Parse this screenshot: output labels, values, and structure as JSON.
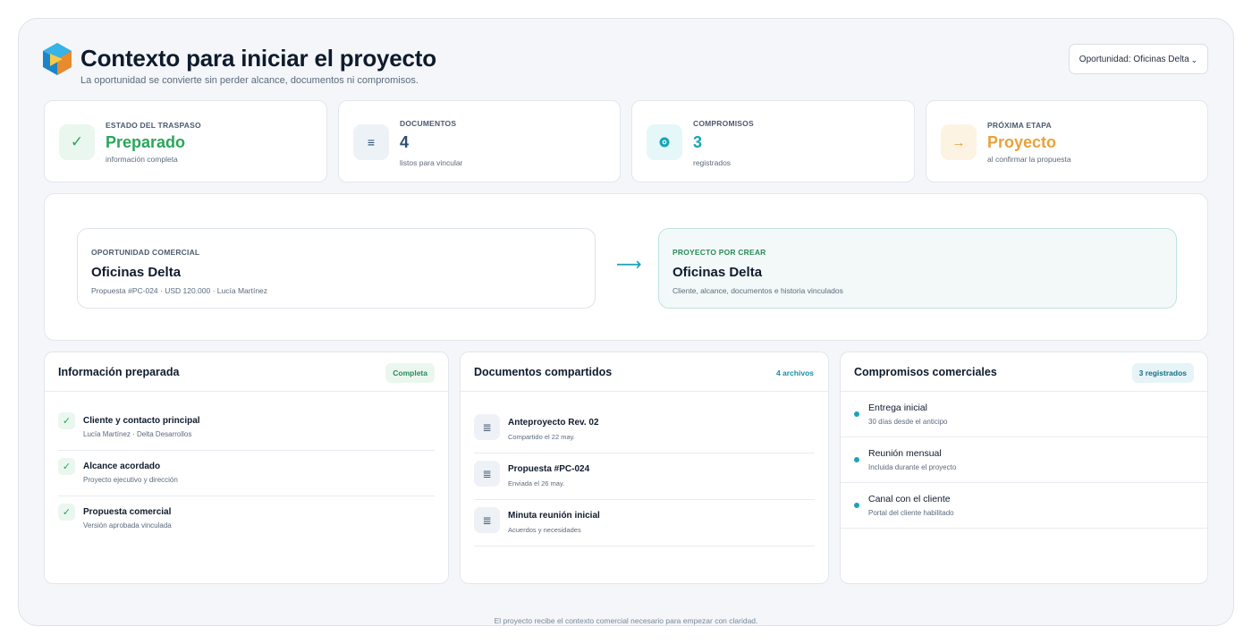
{
  "header": {
    "title": "Contexto para iniciar el proyecto",
    "subtitle": "La oportunidad se convierte sin perder alcance, documentos ni compromisos.",
    "opportunity_select": "Oportunidad: Oficinas Delta"
  },
  "kpis": [
    {
      "label": "ESTADO DEL TRASPASO",
      "value": "Preparado",
      "sub": "información completa",
      "icon": "check-icon",
      "color": "#2aa65a"
    },
    {
      "label": "DOCUMENTOS",
      "value": "4",
      "sub": "listos para vincular",
      "icon": "list-icon",
      "color": "#2c4f74"
    },
    {
      "label": "COMPROMISOS",
      "value": "3",
      "sub": "registrados",
      "icon": "commitment-icon",
      "color": "#1aa3b8"
    },
    {
      "label": "PRÓXIMA ETAPA",
      "value": "Proyecto",
      "sub": "al confirmar la propuesta",
      "icon": "arrow-right-icon",
      "color": "#e8a23a"
    }
  ],
  "flow": {
    "source": {
      "label": "OPORTUNIDAD COMERCIAL",
      "title": "Oficinas Delta",
      "sub": "Propuesta #PC-024 · USD 120.000 · Lucía Martínez"
    },
    "target": {
      "label": "PROYECTO POR CREAR",
      "title": "Oficinas Delta",
      "sub": "Cliente, alcance, documentos e historia vinculados"
    }
  },
  "info_panel": {
    "title": "Información preparada",
    "badge": "Completa",
    "items": [
      {
        "title": "Cliente y contacto principal",
        "sub": "Lucía Martínez · Delta Desarrollos"
      },
      {
        "title": "Alcance acordado",
        "sub": "Proyecto ejecutivo y dirección"
      },
      {
        "title": "Propuesta comercial",
        "sub": "Versión aprobada vinculada"
      }
    ]
  },
  "docs_panel": {
    "title": "Documentos compartidos",
    "badge": "4 archivos",
    "items": [
      {
        "title": "Anteproyecto Rev. 02",
        "sub": "Compartido el 22 may."
      },
      {
        "title": "Propuesta #PC-024",
        "sub": "Enviada el 26 may."
      },
      {
        "title": "Minuta reunión inicial",
        "sub": "Acuerdos y necesidades"
      }
    ]
  },
  "commit_panel": {
    "title": "Compromisos comerciales",
    "badge": "3 registrados",
    "items": [
      {
        "title": "Entrega inicial",
        "sub": "30 días desde el anticipo"
      },
      {
        "title": "Reunión mensual",
        "sub": "Incluida durante el proyecto"
      },
      {
        "title": "Canal con el cliente",
        "sub": "Portal del cliente habilitado"
      }
    ]
  },
  "footer": "El proyecto recibe el contexto comercial necesario para empezar con claridad.",
  "colors": {
    "accent": "#1aa3b8",
    "success": "#2aa65a",
    "warning": "#e8a23a",
    "dark": "#0f1b2d"
  }
}
